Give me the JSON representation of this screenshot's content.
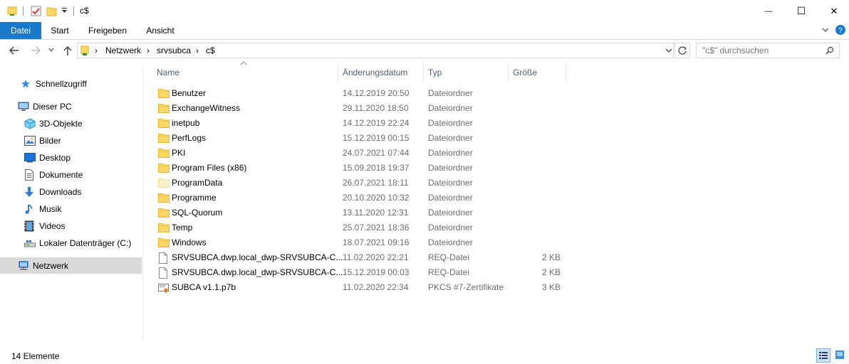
{
  "window": {
    "title": "c$",
    "minimize_glyph": "—",
    "maximize_glyph": "☐",
    "close_glyph": "✕"
  },
  "ribbon": {
    "tabs": [
      "Datei",
      "Start",
      "Freigeben",
      "Ansicht"
    ],
    "file_tab_color": "#1979ca"
  },
  "address": {
    "crumbs": [
      "Netzwerk",
      "srvsubca",
      "c$"
    ],
    "separator": "›"
  },
  "search": {
    "placeholder": "\"c$\" durchsuchen"
  },
  "nav": {
    "items": [
      {
        "label": "Schnellzugriff",
        "icon": "star-icon"
      },
      {
        "label": "Dieser PC",
        "icon": "computer-icon"
      },
      {
        "label": "3D-Objekte",
        "icon": "cube-icon"
      },
      {
        "label": "Bilder",
        "icon": "pictures-icon"
      },
      {
        "label": "Desktop",
        "icon": "desktop-icon"
      },
      {
        "label": "Dokumente",
        "icon": "documents-icon"
      },
      {
        "label": "Downloads",
        "icon": "download-icon"
      },
      {
        "label": "Musik",
        "icon": "music-icon"
      },
      {
        "label": "Videos",
        "icon": "videos-icon"
      },
      {
        "label": "Lokaler Datenträger (C:)",
        "icon": "drive-icon"
      },
      {
        "label": "Netzwerk",
        "icon": "network-icon"
      }
    ]
  },
  "columns": {
    "name": "Name",
    "date": "Änderungsdatum",
    "type": "Typ",
    "size": "Größe"
  },
  "files": [
    {
      "name": "Benutzer",
      "date": "14.12.2019 20:50",
      "type": "Dateiordner",
      "size": "",
      "icon": "folder-icon"
    },
    {
      "name": "ExchangeWitness",
      "date": "29.11.2020 18:50",
      "type": "Dateiordner",
      "size": "",
      "icon": "folder-icon"
    },
    {
      "name": "inetpub",
      "date": "14.12.2019 22:24",
      "type": "Dateiordner",
      "size": "",
      "icon": "folder-icon"
    },
    {
      "name": "PerfLogs",
      "date": "15.12.2019 00:15",
      "type": "Dateiordner",
      "size": "",
      "icon": "folder-icon"
    },
    {
      "name": "PKI",
      "date": "24.07.2021 07:44",
      "type": "Dateiordner",
      "size": "",
      "icon": "folder-icon"
    },
    {
      "name": "Program Files (x86)",
      "date": "15.09.2018 19:37",
      "type": "Dateiordner",
      "size": "",
      "icon": "folder-icon"
    },
    {
      "name": "ProgramData",
      "date": "26.07.2021 18:11",
      "type": "Dateiordner",
      "size": "",
      "icon": "hidden-folder-icon"
    },
    {
      "name": "Programme",
      "date": "20.10.2020 10:32",
      "type": "Dateiordner",
      "size": "",
      "icon": "folder-icon"
    },
    {
      "name": "SQL-Quorum",
      "date": "13.11.2020 12:31",
      "type": "Dateiordner",
      "size": "",
      "icon": "folder-icon"
    },
    {
      "name": "Temp",
      "date": "25.07.2021 18:36",
      "type": "Dateiordner",
      "size": "",
      "icon": "folder-icon"
    },
    {
      "name": "Windows",
      "date": "18.07.2021 09:16",
      "type": "Dateiordner",
      "size": "",
      "icon": "folder-icon"
    },
    {
      "name": "SRVSUBCA.dwp.local_dwp-SRVSUBCA-C...",
      "date": "11.02.2020 22:21",
      "type": "REQ-Datei",
      "size": "2 KB",
      "icon": "file-icon"
    },
    {
      "name": "SRVSUBCA.dwp.local_dwp-SRVSUBCA-C...",
      "date": "15.12.2019 00:03",
      "type": "REQ-Datei",
      "size": "2 KB",
      "icon": "file-icon"
    },
    {
      "name": "SUBCA v1.1.p7b",
      "date": "11.02.2020 22:34",
      "type": "PKCS #7-Zertifikate",
      "size": "3 KB",
      "icon": "certificate-icon"
    }
  ],
  "status": {
    "count": "14 Elemente"
  },
  "colors": {
    "folder": "#ffd766",
    "folder_dark": "#e8b730",
    "accent": "#1979ca",
    "selection": "#d9d9d9"
  }
}
